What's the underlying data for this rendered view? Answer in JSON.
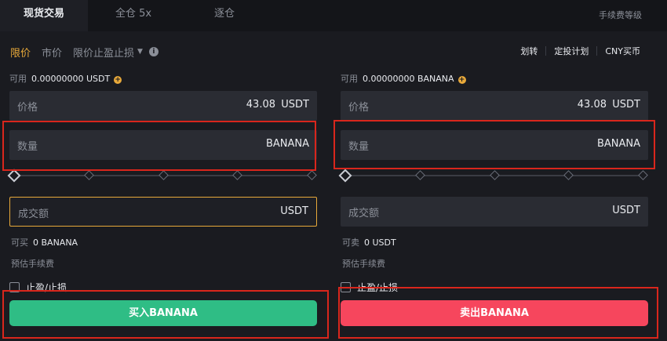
{
  "tabs": [
    {
      "label": "现货交易"
    },
    {
      "label": "全仓 5x"
    },
    {
      "label": "逐仓"
    }
  ],
  "fee_tier": "手续费等级",
  "order_types": [
    {
      "label": "限价"
    },
    {
      "label": "市价"
    },
    {
      "label": "限价止盈止损"
    }
  ],
  "top_links": [
    "划转",
    "定投计划",
    "CNY买币"
  ],
  "buy": {
    "available_label": "可用",
    "available_value": "0.00000000 USDT",
    "price_label": "价格",
    "price_value": "43.08",
    "price_unit": "USDT",
    "qty_label": "数量",
    "qty_unit": "BANANA",
    "total_label": "成交额",
    "total_unit": "USDT",
    "can_label": "可买",
    "can_value": "0 BANANA",
    "fee_label": "预估手续费",
    "tpsl_label": "止盈/止损",
    "button": "买入BANANA"
  },
  "sell": {
    "available_label": "可用",
    "available_value": "0.00000000 BANANA",
    "price_label": "价格",
    "price_value": "43.08",
    "price_unit": "USDT",
    "qty_label": "数量",
    "qty_unit": "BANANA",
    "total_label": "成交额",
    "total_unit": "USDT",
    "can_label": "可卖",
    "can_value": "0 USDT",
    "fee_label": "预估手续费",
    "tpsl_label": "止盈/止损",
    "button": "卖出BANANA"
  },
  "colors": {
    "accent": "#e8a93a",
    "buy": "#2fbd85",
    "sell": "#f6465d",
    "highlight": "#d9261c"
  }
}
